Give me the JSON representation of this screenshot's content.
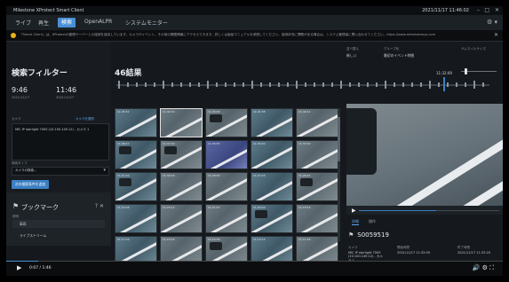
{
  "app_title": "Milestone XProtect Smart Client",
  "datetime": "2021/11/17 11:46:02",
  "window_controls": [
    "–",
    "□",
    "✕"
  ],
  "tabs": [
    {
      "label": "ライブ",
      "active": false
    },
    {
      "label": "再生",
      "active": false
    },
    {
      "label": "検索",
      "active": true
    },
    {
      "label": "OpenALPR",
      "active": false
    },
    {
      "label": "システムモニター",
      "active": false
    }
  ],
  "notice": "「Smart Client」は、XProtectの管理サーバーとの接続を保持しています。カメラやイベント、その他の関連情報にアクセスできます。詳しくは製品マニュアルを参照してください。接続状況に問題がある場合は、システム管理者に問い合わせてください。https://www.milestonesys.com",
  "left": {
    "title": "検索フィルター",
    "from_time": "9:46",
    "from_date": "2021/11/17",
    "to_time": "11:46",
    "to_date": "2021/11/17",
    "cameras_label": "カメラ",
    "camera_value": "MIC IP starlight 7000 (10.100.149.12) - カメラ 1",
    "camera_link": "カメラを選択",
    "search_type_label": "検索タイプ",
    "search_type_value": "カメラの検索...",
    "search_button": "次の検索条件を追加",
    "bookmarks": {
      "title": "ブックマーク",
      "field_label": "説明",
      "items": [
        "車両",
        "ライブストリーム"
      ]
    }
  },
  "center": {
    "result_count": "46結果",
    "timeline_time": "11:32:09",
    "thumbnails": [
      "11:45:52",
      "11:44:10",
      "11:43:05",
      "11:41:38",
      "11:40:11",
      "11:38:47",
      "11:37:20",
      "11:35:55",
      "11:34:30",
      "11:33:02",
      "11:31:40",
      "11:30:16",
      "11:28:50",
      "11:27:23",
      "11:26:01",
      "11:24:38",
      "11:23:12",
      "11:21:47",
      "11:20:20",
      "11:18:54",
      "11:17:29",
      "11:16:03",
      "11:14:38",
      "11:13:12",
      "11:11:46"
    ]
  },
  "top_right": {
    "sort_label": "並べ替え",
    "sort_value": "新しい",
    "group_label": "グループ化",
    "group_value": "最初のイベント時間",
    "view_label": "サムネイルサイズ"
  },
  "video": {
    "tabs": [
      "詳細",
      "操作"
    ],
    "id": "S0059519",
    "camera_label": "カメラ",
    "camera_value": "MIC IP starlight 7000 (10.100.149.12) - カメラ 1",
    "start_label": "開始時間",
    "start_value": "2021/11/17 11:32:09",
    "end_label": "終了時間",
    "end_value": "2021/11/17 11:32:20",
    "progress": 0.55
  },
  "player": {
    "time": "0:07 / 1:46",
    "progress": 0.065
  }
}
